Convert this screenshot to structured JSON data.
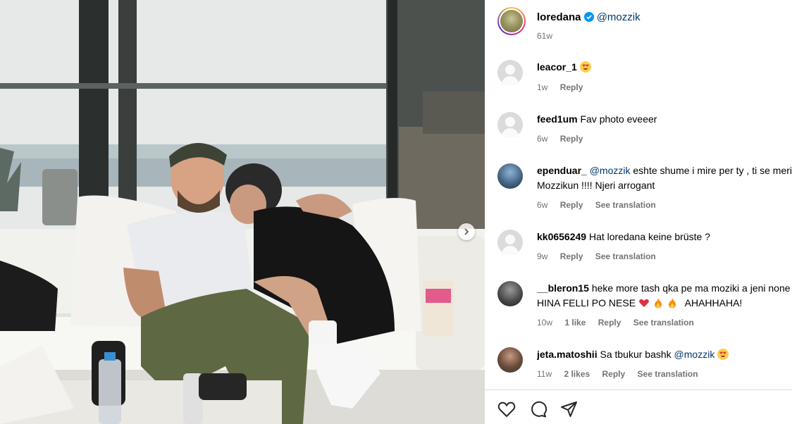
{
  "post": {
    "author": "loredana",
    "mention": "@mozzik",
    "time": "61w"
  },
  "comments": [
    {
      "user": "leacor_1",
      "text": "",
      "emoji": "heart-eyes",
      "line2": "",
      "time": "1w",
      "likes": "",
      "reply": "Reply",
      "translate": ""
    },
    {
      "user": "feed1um",
      "text": "Fav photo eveeer",
      "emoji": "",
      "line2": "",
      "time": "6w",
      "likes": "",
      "reply": "Reply",
      "translate": ""
    },
    {
      "user": "ependuar_",
      "mention": "@mozzik",
      "text": "eshte shume i mire per ty , ti se meriton",
      "line2": "Mozzikun !!!! Njeri arrogant",
      "time": "6w",
      "likes": "",
      "reply": "Reply",
      "translate": "See translation"
    },
    {
      "user": "kk0656249",
      "text": "Hat loredana keine brüste ?",
      "line2": "",
      "time": "9w",
      "likes": "",
      "reply": "Reply",
      "translate": "See translation"
    },
    {
      "user": "__bleron15",
      "text": "heke more tash qka pe ma moziki a jeni none",
      "line2": "HINA FELLI PO NESE",
      "line2_tail": "AHAHHAHA!",
      "time": "10w",
      "likes": "1 like",
      "reply": "Reply",
      "translate": "See translation"
    },
    {
      "user": "jeta.matoshii",
      "text": "Sa tbukur bashk",
      "mention": "@mozzik",
      "time": "11w",
      "likes": "2 likes",
      "reply": "Reply",
      "translate": "See translation"
    }
  ],
  "colors": {
    "link": "#00376b",
    "muted": "#737373",
    "verified": "#0095f6"
  },
  "icons": [
    "heart-icon",
    "comment-icon",
    "share-icon",
    "verified-icon",
    "chevron-right-icon"
  ]
}
